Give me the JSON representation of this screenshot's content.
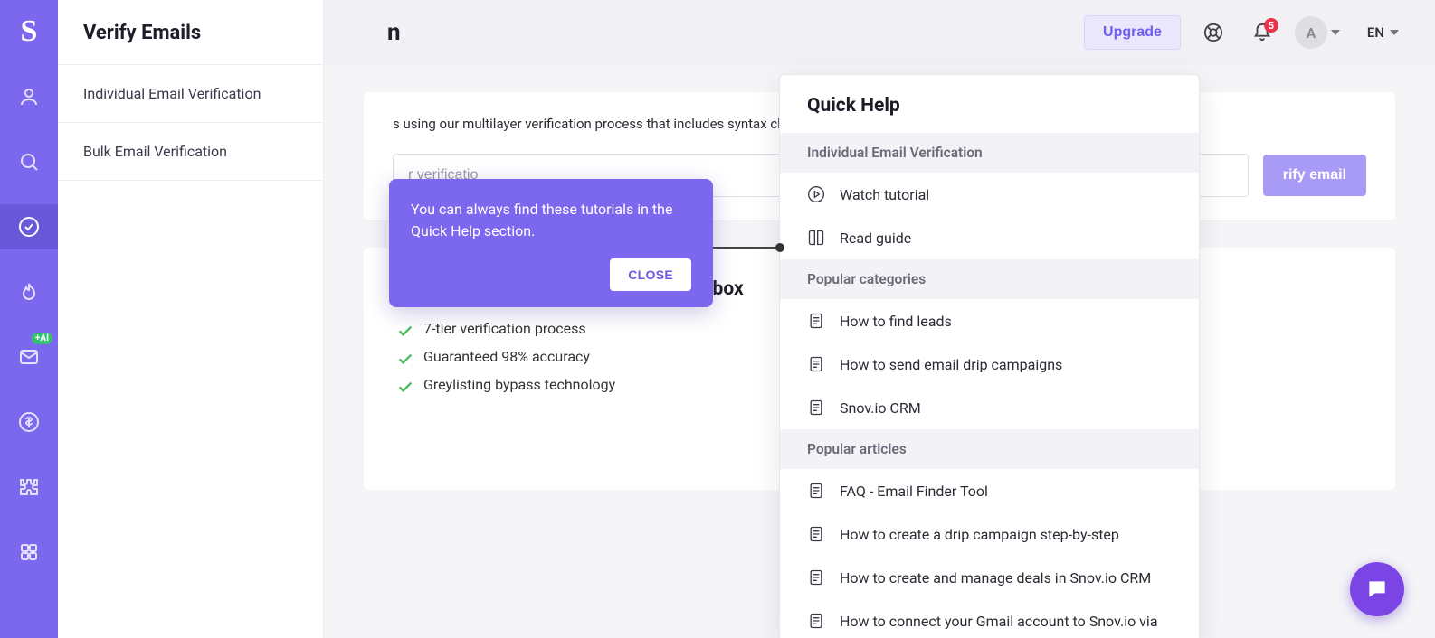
{
  "rail": {
    "logo": "S",
    "ai_badge": "+AI"
  },
  "submenu": {
    "title": "Verify Emails",
    "items": [
      "Individual Email Verification",
      "Bulk Email Verification"
    ]
  },
  "topbar": {
    "page_title_fragment": "n",
    "upgrade": "Upgrade",
    "notif_count": "5",
    "avatar_letter": "A",
    "lang": "EN"
  },
  "main": {
    "desc_fragment": "s using our multilayer verification process that includes syntax check, M",
    "input_placeholder_fragment": "r verificatio",
    "verify_btn_fragment": "rify email"
  },
  "promo": {
    "heading": "Be confident you'll reach the lead's inbox",
    "bullets": [
      "7-tier verification process",
      "Guaranteed 98% accuracy",
      "Greylisting bypass technology"
    ]
  },
  "tooltip": {
    "text": "You can always find these tutorials in the Quick Help section.",
    "close": "CLOSE"
  },
  "quick_help": {
    "title": "Quick Help",
    "section1": "Individual Email Verification",
    "items1": [
      "Watch tutorial",
      "Read guide"
    ],
    "section2": "Popular categories",
    "items2": [
      "How to find leads",
      "How to send email drip campaigns",
      "Snov.io CRM"
    ],
    "section3": "Popular articles",
    "items3": [
      "FAQ - Email Finder Tool",
      "How to create a drip campaign step-by-step",
      "How to create and manage deals in Snov.io CRM",
      "How to connect your Gmail account to Snov.io via"
    ]
  }
}
